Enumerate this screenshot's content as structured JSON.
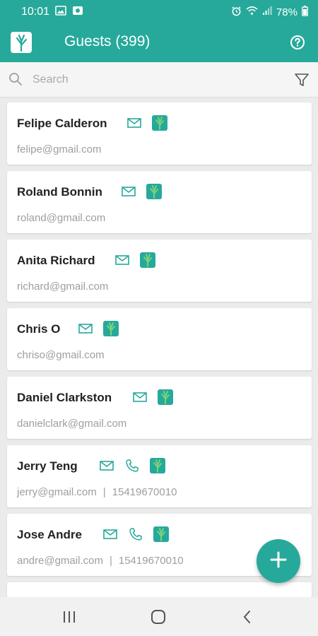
{
  "status_bar": {
    "time": "10:01",
    "battery": "78%"
  },
  "header": {
    "title": "Guests (399)",
    "logo_icon": "tree-logo-icon",
    "help_icon": "help-circle-icon"
  },
  "search": {
    "placeholder": "Search",
    "value": "",
    "filter_icon": "filter-icon"
  },
  "guests": [
    {
      "name": "Felipe Calderon",
      "email": "felipe@gmail.com",
      "phone": ""
    },
    {
      "name": "Roland Bonnin",
      "email": "roland@gmail.com",
      "phone": ""
    },
    {
      "name": "Anita Richard",
      "email": "richard@gmail.com",
      "phone": ""
    },
    {
      "name": "Chris O",
      "email": "chriso@gmail.com",
      "phone": ""
    },
    {
      "name": "Daniel Clarkston",
      "email": "danielclark@gmail.com",
      "phone": ""
    },
    {
      "name": "Jerry Teng",
      "email": "jerry@gmail.com",
      "phone": "15419670010"
    },
    {
      "name": "Jose Andre",
      "email": "andre@gmail.com",
      "phone": "15419670010"
    }
  ],
  "separator": "|",
  "colors": {
    "accent": "#26a99a",
    "background": "#ebebeb"
  },
  "fab": {
    "icon": "add-icon"
  },
  "nav": {
    "recents_icon": "recents-icon",
    "home_icon": "home-icon",
    "back_icon": "back-icon"
  }
}
